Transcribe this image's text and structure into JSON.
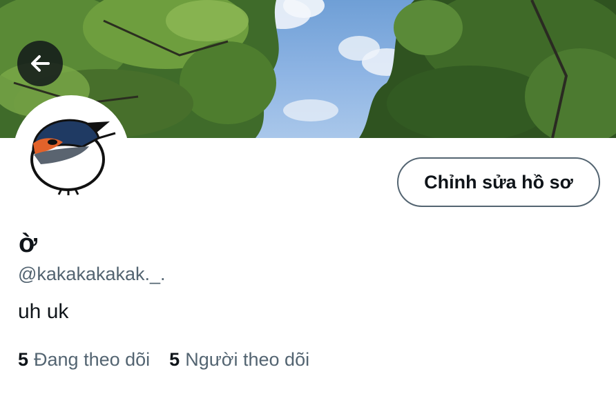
{
  "header": {
    "back_icon": "arrow-left-icon"
  },
  "profile": {
    "avatar_icon": "swallow-bird-avatar",
    "edit_button_label": "Chỉnh sửa hồ sơ",
    "display_name": "ờ",
    "handle": "@kakakakakak._.",
    "bio": "uh uk",
    "following_count": "5",
    "following_label": "Đang theo dõi",
    "followers_count": "5",
    "followers_label": "Người theo dõi"
  },
  "colors": {
    "text_primary": "#0f1419",
    "text_secondary": "#536471",
    "background": "#ffffff"
  }
}
